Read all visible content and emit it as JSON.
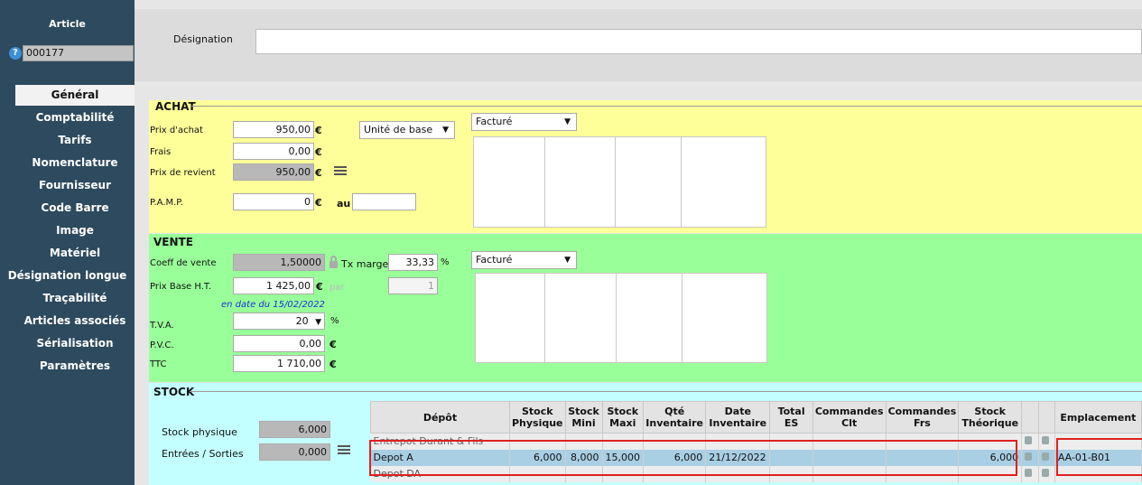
{
  "article": {
    "title": "Article",
    "help_icon": "?",
    "code": "000177"
  },
  "header": {
    "designation_label": "Désignation",
    "designation_value": ""
  },
  "nav": {
    "items": [
      {
        "label": "Général",
        "active": true
      },
      {
        "label": "Comptabilité"
      },
      {
        "label": "Tarifs"
      },
      {
        "label": "Nomenclature"
      },
      {
        "label": "Fournisseur"
      },
      {
        "label": "Code Barre"
      },
      {
        "label": "Image"
      },
      {
        "label": "Matériel"
      },
      {
        "label": "Désignation longue"
      },
      {
        "label": "Traçabilité"
      },
      {
        "label": "Articles associés"
      },
      {
        "label": "Sérialisation"
      },
      {
        "label": "Paramètres"
      }
    ]
  },
  "achat": {
    "title": "ACHAT",
    "prix_achat_label": "Prix d'achat",
    "prix_achat_value": "950,00",
    "frais_label": "Frais",
    "frais_value": "0,00",
    "prix_revient_label": "Prix de revient",
    "prix_revient_value": "950,00",
    "pamp_label": "P.A.M.P.",
    "pamp_value": "0",
    "au_label": "au",
    "au_value": "",
    "currency": "€",
    "unit_select": "Unité de base",
    "facture_select": "Facturé"
  },
  "vente": {
    "title": "VENTE",
    "coeff_label": "Coeff de vente",
    "coeff_value": "1,50000",
    "tx_marge_label": "Tx marge",
    "tx_marge_value": "33,33",
    "percent": "%",
    "prix_base_label": "Prix Base H.T.",
    "prix_base_value": "1 425,00",
    "par_label": "par",
    "par_value": "1",
    "en_date": "en date du 15/02/2022",
    "tva_label": "T.V.A.",
    "tva_value": "20",
    "pvc_label": "P.V.C.",
    "pvc_value": "0,00",
    "ttc_label": "TTC",
    "ttc_value": "1 710,00",
    "currency": "€",
    "facture_select": "Facturé"
  },
  "stock": {
    "title": "STOCK",
    "stock_physique_label": "Stock physique",
    "stock_physique_value": "6,000",
    "entrees_sorties_label": "Entrées / Sorties",
    "entrees_sorties_value": "0,000",
    "columns": [
      "Dépôt",
      "Stock Physique",
      "Stock Mini",
      "Stock Maxi",
      "Qté Inventaire",
      "Date Inventaire",
      "Total ES",
      "Commandes Clt",
      "Commandes Frs",
      "Stock Théorique",
      "",
      "",
      "Emplacement"
    ],
    "rows": [
      {
        "depot": "Entrepot Durant & Fils",
        "physique": "",
        "mini": "",
        "maxi": "",
        "qte_inv": "",
        "date_inv": "",
        "total_es": "",
        "cmd_clt": "",
        "cmd_frs": "",
        "theorique": "",
        "emplacement": ""
      },
      {
        "depot": "Depot A",
        "physique": "6,000",
        "mini": "8,000",
        "maxi": "15,000",
        "qte_inv": "6,000",
        "date_inv": "21/12/2022",
        "total_es": "",
        "cmd_clt": "",
        "cmd_frs": "",
        "theorique": "6,000",
        "emplacement": "AA-01-B01"
      },
      {
        "depot": "Depot DA",
        "physique": "",
        "mini": "",
        "maxi": "",
        "qte_inv": "",
        "date_inv": "",
        "total_es": "",
        "cmd_clt": "",
        "cmd_frs": "",
        "theorique": "",
        "emplacement": ""
      }
    ]
  }
}
